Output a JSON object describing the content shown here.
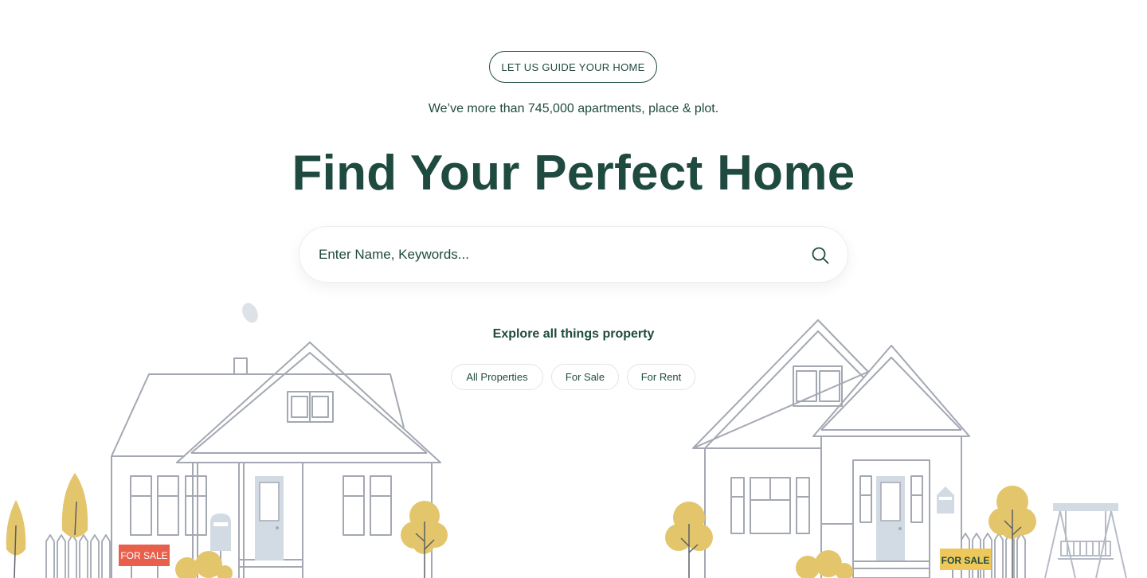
{
  "hero": {
    "guide_button": "LET US GUIDE YOUR HOME",
    "subtitle": "We’ve more than 745,000 apartments, place & plot.",
    "title": "Find Your Perfect Home"
  },
  "search": {
    "placeholder": "Enter Name, Keywords...",
    "icon": "search-icon"
  },
  "explore": {
    "heading": "Explore all things property",
    "tabs": [
      {
        "label": "All Properties"
      },
      {
        "label": "For Sale"
      },
      {
        "label": "For Rent"
      }
    ]
  },
  "illustration": {
    "sign_left": "FOR SALE",
    "sign_right": "FOR SALE"
  },
  "colors": {
    "primary": "#1f4a40",
    "line": "#a3a8b2",
    "tree": "#e3c56c",
    "sign_red": "#e8604c",
    "sign_yellow": "#eec85a",
    "door": "#d2dbe3"
  }
}
